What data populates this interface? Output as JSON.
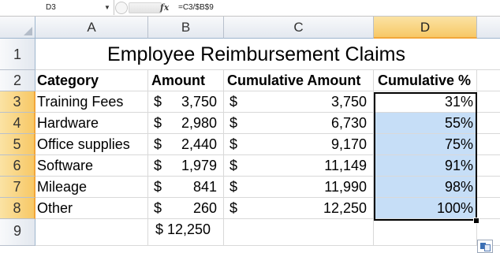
{
  "formula_bar": {
    "name_box": "D3",
    "fx_label": "fx",
    "formula": "=C3/$B$9"
  },
  "columns": [
    "A",
    "B",
    "C",
    "D"
  ],
  "selected_column": "D",
  "rows": [
    "1",
    "2",
    "3",
    "4",
    "5",
    "6",
    "7",
    "8",
    "9"
  ],
  "title": "Employee Reimbursement Claims",
  "headers": {
    "category": "Category",
    "amount": "Amount",
    "cumulative_amount": "Cumulative Amount",
    "cumulative_pct": "Cumulative %"
  },
  "data_rows": [
    {
      "category": "Training Fees",
      "amount_sym": "$",
      "amount": "3,750",
      "cum_sym": "$",
      "cum_amount": "3,750",
      "cum_pct": "31%"
    },
    {
      "category": "Hardware",
      "amount_sym": "$",
      "amount": "2,980",
      "cum_sym": "$",
      "cum_amount": "6,730",
      "cum_pct": "55%"
    },
    {
      "category": "Office supplies",
      "amount_sym": "$",
      "amount": "2,440",
      "cum_sym": "$",
      "cum_amount": "9,170",
      "cum_pct": "75%"
    },
    {
      "category": "Software",
      "amount_sym": "$",
      "amount": "1,979",
      "cum_sym": "$",
      "cum_amount": "11,149",
      "cum_pct": "91%"
    },
    {
      "category": "Mileage",
      "amount_sym": "$",
      "amount": "841",
      "cum_sym": "$",
      "cum_amount": "11,990",
      "cum_pct": "98%"
    },
    {
      "category": "Other",
      "amount_sym": "$",
      "amount": "260",
      "cum_sym": "$",
      "cum_amount": "12,250",
      "cum_pct": "100%"
    }
  ],
  "total": "$ 12,250",
  "selection": {
    "active_cell": "D3",
    "range": "D3:D8",
    "highlight_color": "#c6def7"
  },
  "icons": {
    "name_box_dropdown": "chevron-down-icon",
    "paste_options": "paste-options-icon"
  }
}
